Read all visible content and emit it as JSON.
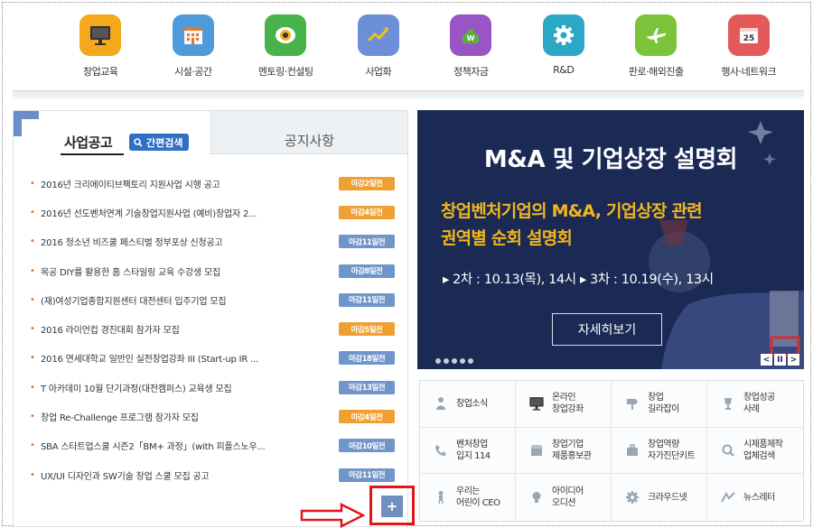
{
  "categories": [
    {
      "label": "창업교육",
      "icon": "monitor-icon",
      "color": "#f4a81c"
    },
    {
      "label": "시설·공간",
      "icon": "building-icon",
      "color": "#4f9ad8"
    },
    {
      "label": "멘토링·컨설팅",
      "icon": "eye-icon",
      "color": "#47b34a"
    },
    {
      "label": "사업화",
      "icon": "growth-chart-icon",
      "color": "#6d8fd8"
    },
    {
      "label": "정책자금",
      "icon": "money-bag-icon",
      "color": "#9a55c5"
    },
    {
      "label": "R&D",
      "icon": "gear-icon",
      "color": "#2aa8c6"
    },
    {
      "label": "판로·해외진출",
      "icon": "airplane-icon",
      "color": "#7cc23a"
    },
    {
      "label": "행사·네트워크",
      "icon": "calendar-icon",
      "color": "#e45a5a",
      "icon_text": "25"
    }
  ],
  "left_panel": {
    "tab_active": "사업공고",
    "quick_search": "간편검색",
    "tab_other": "공지사항",
    "notices": [
      {
        "title": "2016년 크리에이티브팩토리 지원사업 시행 공고",
        "badge": "마감2일전",
        "badge_color": "#f0a030"
      },
      {
        "title": "2016년 선도벤처연계 기술창업지원사업 (예비)창업자 2...",
        "badge": "마감4일전",
        "badge_color": "#f0a030"
      },
      {
        "title": "2016 청소년 비즈쿨 페스티벌 정부포상 신청공고",
        "badge": "마감11일전",
        "badge_color": "#6f95c9"
      },
      {
        "title": "목공 DIY를 활용한 홈 스타일링 교육 수강생 모집",
        "badge": "마감8일전",
        "badge_color": "#6f95c9"
      },
      {
        "title": "(재)여성기업종합지원센터 대전센터 입주기업 모집",
        "badge": "마감11일전",
        "badge_color": "#6f95c9"
      },
      {
        "title": "2016 라이언컵 경진대회 참가자 모집",
        "badge": "마감5일전",
        "badge_color": "#f0a030"
      },
      {
        "title": "2016 연세대학교 일반인 실전창업강좌 III (Start-up IR ...",
        "badge": "마감18일전",
        "badge_color": "#6f95c9"
      },
      {
        "title": "T 아카데미 10월 단기과정(대전캠퍼스) 교육생 모집",
        "badge": "마감13일전",
        "badge_color": "#6f95c9"
      },
      {
        "title": "창업 Re-Challenge 프로그램 참가자 모집",
        "badge": "마감4일전",
        "badge_color": "#f0a030"
      },
      {
        "title": "SBA 스타트업스쿨 시즌2「BM+ 과정」(with 피플스노우...",
        "badge": "마감10일전",
        "badge_color": "#6f95c9"
      },
      {
        "title": "UX/UI 디자인과 SW기술 창업 스쿨 모집 공고",
        "badge": "마감11일전",
        "badge_color": "#6f95c9"
      }
    ],
    "more_button": "+"
  },
  "banner": {
    "title": "M&A 및 기업상장 설명회",
    "subtitle_line1": "창업벤처기업의 M&A, 기업상장 관련",
    "subtitle_line2": "권역별 순회 설명회",
    "dates": "▸ 2차 : 10.13(목), 14시   ▸ 3차 : 10.19(수), 13시",
    "more_label": "자세히보기",
    "ctrl_prev": "<",
    "ctrl_pause": "II",
    "ctrl_next": ">"
  },
  "quick_menu": [
    {
      "label": "창업소식",
      "icon": "person-icon"
    },
    {
      "label": "온라인\n창업강좌",
      "icon": "monitor-icon"
    },
    {
      "label": "창업\n길라잡이",
      "icon": "signpost-icon"
    },
    {
      "label": "창업성공\n사례",
      "icon": "trophy-icon"
    },
    {
      "label": "벤처창업\n입지 114",
      "icon": "phone-icon"
    },
    {
      "label": "창업기업\n제품홍보관",
      "icon": "shop-icon"
    },
    {
      "label": "창업역량\n자가진단키트",
      "icon": "kit-icon"
    },
    {
      "label": "시제품제작\n업체검색",
      "icon": "search-icon"
    },
    {
      "label": "우리는\n어린이 CEO",
      "icon": "child-icon"
    },
    {
      "label": "아이디어\n오디션",
      "icon": "lightbulb-icon"
    },
    {
      "label": "크라우드넷",
      "icon": "gear-icon"
    },
    {
      "label": "뉴스레터",
      "icon": "newsletter-icon"
    }
  ]
}
